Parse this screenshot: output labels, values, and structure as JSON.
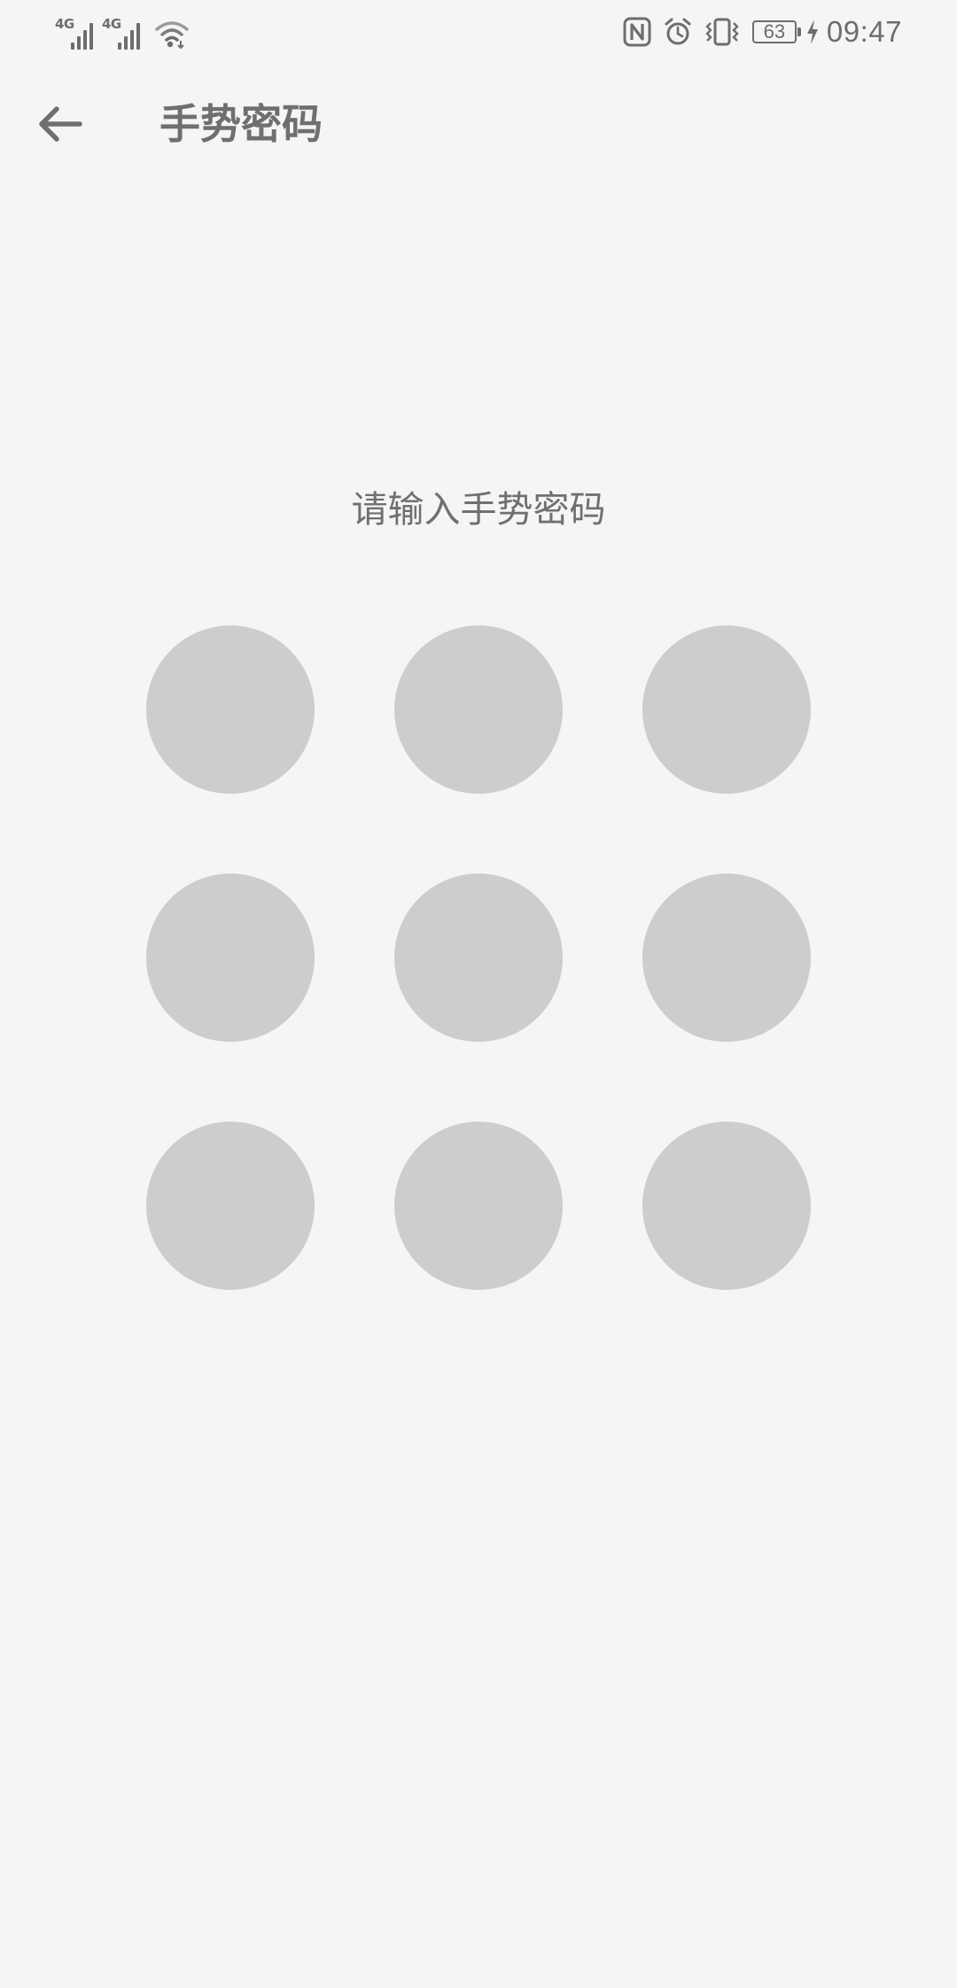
{
  "status_bar": {
    "sim1_network": "4G",
    "sim2_network": "4G",
    "battery_level": "63",
    "time": "09:47",
    "icons": [
      "signal-icon",
      "signal-icon",
      "wifi-icon",
      "nfc-icon",
      "alarm-icon",
      "vibrate-icon",
      "battery-icon",
      "charging-icon"
    ]
  },
  "toolbar": {
    "back_icon": "back-arrow-icon",
    "title": "手势密码"
  },
  "main": {
    "prompt": "请输入手势密码",
    "pattern_dots": [
      1,
      2,
      3,
      4,
      5,
      6,
      7,
      8,
      9
    ]
  },
  "colors": {
    "background": "#f5f5f5",
    "text": "#6f6f6f",
    "dot": "#cdcdcd"
  }
}
